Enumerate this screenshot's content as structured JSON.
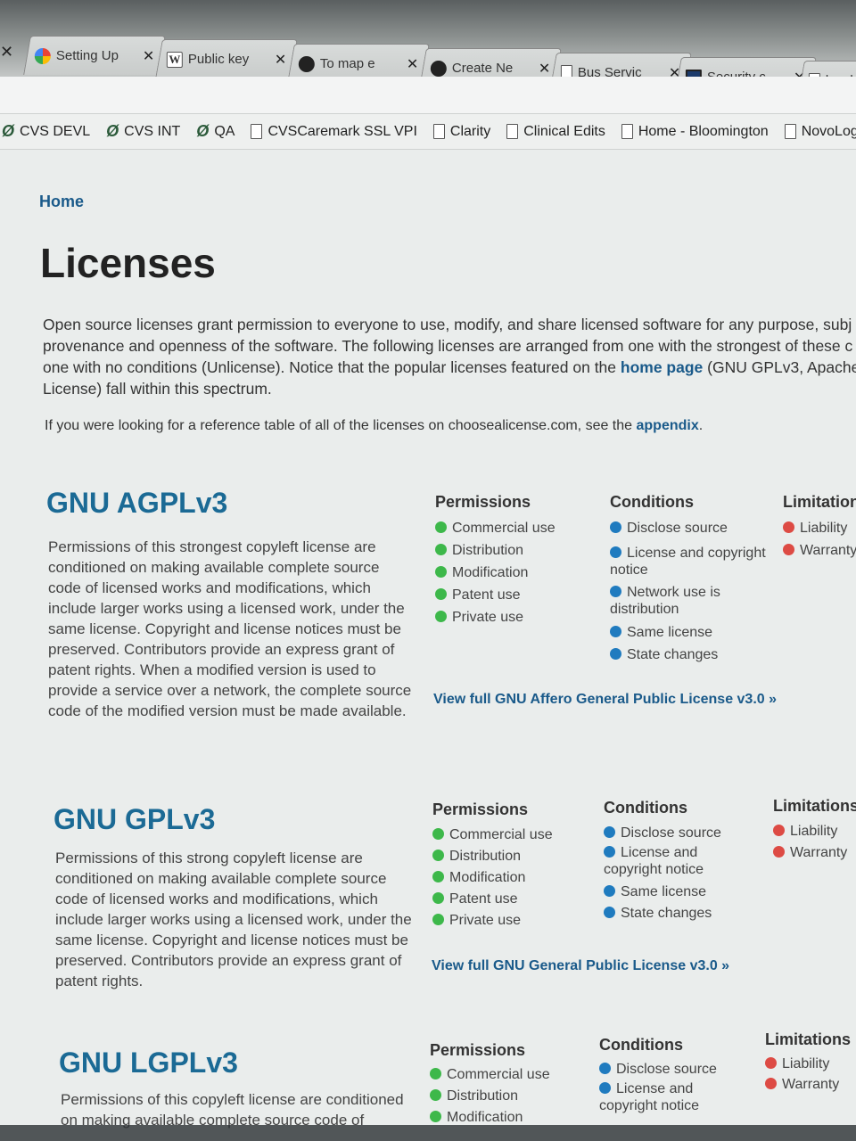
{
  "tabs": [
    {
      "label": "",
      "icon": "none"
    },
    {
      "label": "Setting Up",
      "icon": "google-icon"
    },
    {
      "label": "Public key",
      "icon": "wikipedia-icon"
    },
    {
      "label": "To map e",
      "icon": "github-icon"
    },
    {
      "label": "Create Ne",
      "icon": "github-icon"
    },
    {
      "label": "Bus Servic",
      "icon": "document-icon"
    },
    {
      "label": "Security c",
      "icon": "security-icon"
    },
    {
      "label": "local",
      "icon": "document-icon"
    }
  ],
  "bookmarks": [
    {
      "label": "CVS DEVL",
      "icon": "cvs-icon"
    },
    {
      "label": "CVS INT",
      "icon": "cvs-icon"
    },
    {
      "label": "QA",
      "icon": "cvs-icon"
    },
    {
      "label": "CVSCaremark SSL VPI",
      "icon": "document-icon"
    },
    {
      "label": "Clarity",
      "icon": "document-icon"
    },
    {
      "label": "Clinical Edits",
      "icon": "document-icon"
    },
    {
      "label": "Home - Bloomington",
      "icon": "document-icon"
    },
    {
      "label": "NovoLogix Ir",
      "icon": "document-icon"
    }
  ],
  "page": {
    "breadcrumb": "Home",
    "title": "Licenses",
    "intro_lines": [
      "Open source licenses grant permission to everyone to use, modify, and share licensed software for any purpose, subj",
      "provenance and openness of the software. The following licenses are arranged from one with the strongest of these c",
      "one with no conditions (Unlicense). Notice that the popular licenses featured on the ",
      "License) fall within this spectrum."
    ],
    "intro_link": "home page",
    "intro_after_link": " (GNU GPLv3, Apache",
    "ref_text": "If you were looking for a reference table of all of the licenses on choosealicense.com, see the ",
    "ref_link": "appendix",
    "ref_end": "."
  },
  "licenses": [
    {
      "title": "GNU AGPLv3",
      "description": "Permissions of this strongest copyleft license are conditioned on making available complete source code of licensed works and modifications, which include larger works using a licensed work, under the same license. Copyright and license notices must be preserved. Contributors provide an express grant of patent rights. When a modified version is used to provide a service over a network, the complete source code of the modified version must be made available.",
      "permissions_label": "Permissions",
      "conditions_label": "Conditions",
      "limitations_label": "Limitation",
      "permissions": [
        "Commercial use",
        "Distribution",
        "Modification",
        "Patent use",
        "Private use"
      ],
      "conditions": [
        "Disclose source",
        "License and copyright notice",
        "Network use is distribution",
        "Same license",
        "State changes"
      ],
      "limitations": [
        "Liability",
        "Warranty"
      ],
      "link": "View full GNU Affero General Public License v3.0 »"
    },
    {
      "title": "GNU GPLv3",
      "description": "Permissions of this strong copyleft license are conditioned on making available complete source code of licensed works and modifications, which include larger works using a licensed work, under the same license. Copyright and license notices must be preserved. Contributors provide an express grant of patent rights.",
      "permissions_label": "Permissions",
      "conditions_label": "Conditions",
      "limitations_label": "Limitations",
      "permissions": [
        "Commercial use",
        "Distribution",
        "Modification",
        "Patent use",
        "Private use"
      ],
      "conditions": [
        "Disclose source",
        "License and copyright notice",
        "Same license",
        "State changes"
      ],
      "limitations": [
        "Liability",
        "Warranty"
      ],
      "link": "View full GNU General Public License v3.0 »"
    },
    {
      "title": "GNU LGPLv3",
      "description": "Permissions of this copyleft license are conditioned on making available complete source code of",
      "permissions_label": "Permissions",
      "conditions_label": "Conditions",
      "limitations_label": "Limitations",
      "permissions": [
        "Commercial use",
        "Distribution",
        "Modification"
      ],
      "conditions": [
        "Disclose source",
        "License and copyright notice"
      ],
      "limitations": [
        "Liability",
        "Warranty"
      ],
      "link": ""
    }
  ],
  "colors": {
    "permission": "#3db84a",
    "condition": "#1f7bbf",
    "limitation": "#dd4b44",
    "link": "#1a5a8a",
    "title": "#1b6a95"
  }
}
